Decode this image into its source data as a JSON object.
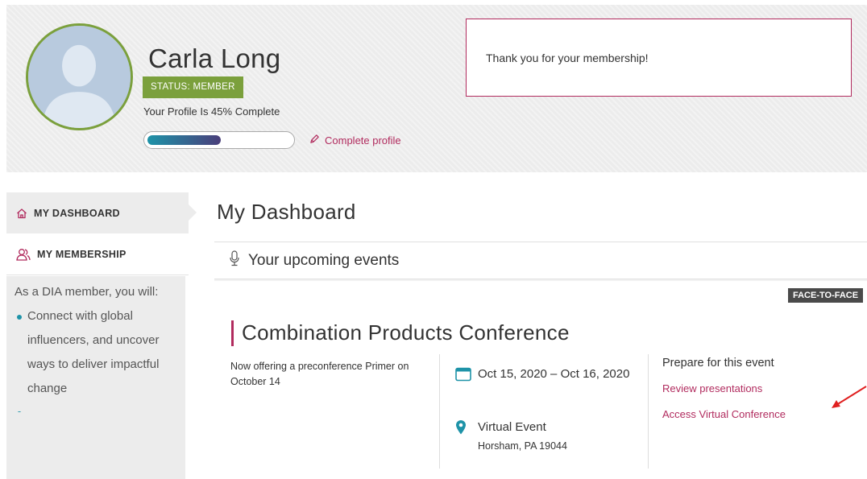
{
  "profile": {
    "name": "Carla Long",
    "status": "STATUS: MEMBER",
    "completion_text": "Your Profile Is 45% Complete",
    "completion_fraction": 0.45,
    "complete_link": "Complete profile",
    "avatar_icon": "person-silhouette-icon"
  },
  "notice": {
    "text": "Thank you for your membership!"
  },
  "sidebar": {
    "items": [
      {
        "label": "MY DASHBOARD",
        "icon": "home-icon",
        "active": true
      },
      {
        "label": "MY MEMBERSHIP",
        "icon": "members-icon",
        "active": false
      }
    ],
    "membership_intro": "As a DIA member, you will:",
    "benefits": [
      "Connect with global influencers, and uncover ways to deliver impactful change"
    ]
  },
  "main": {
    "title": "My Dashboard",
    "section_title": "Your upcoming events",
    "section_icon": "microphone-icon",
    "event": {
      "tag": "FACE-TO-FACE",
      "title": "Combination Products Conference",
      "description": "Now offering a preconference Primer on October 14",
      "date": "Oct 15, 2020 – Oct 16, 2020",
      "location_title": "Virtual Event",
      "location_sub": "Horsham, PA 19044",
      "prepare_heading": "Prepare for this event",
      "links": [
        "Review presentations",
        "Access Virtual Conference"
      ]
    }
  },
  "colors": {
    "accent": "#b12b5e",
    "member_green": "#7ba03c",
    "teal": "#1e93a8",
    "annotation_arrow": "#e02020"
  }
}
